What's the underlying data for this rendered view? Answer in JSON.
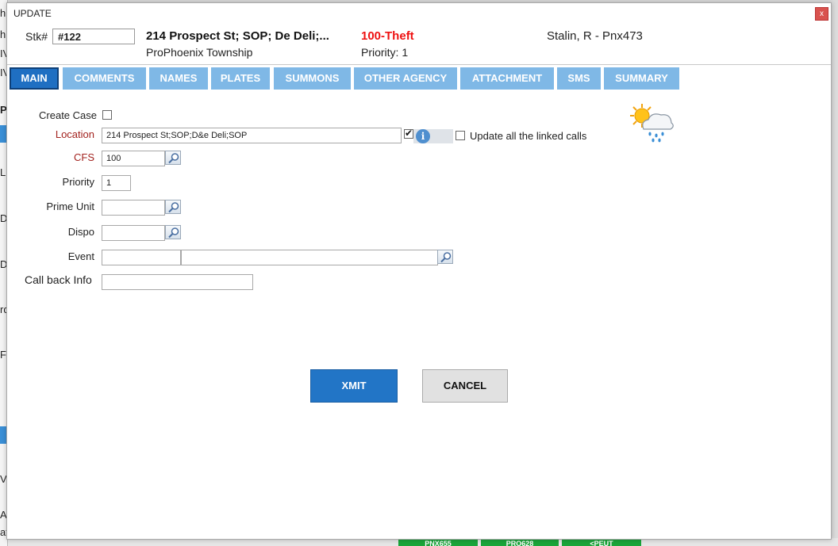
{
  "dialog": {
    "title": "UPDATE",
    "close_label": "x"
  },
  "header": {
    "stk_label": "Stk#",
    "stk_value": "#122",
    "address": "214 Prospect St; SOP; De Deli;...",
    "township": "ProPhoenix Township",
    "call_type": "100-Theft",
    "priority_text": "Priority: 1",
    "dispatcher": "Stalin, R - Pnx473"
  },
  "tabs": [
    {
      "label": "MAIN",
      "active": true
    },
    {
      "label": "COMMENTS"
    },
    {
      "label": "NAMES"
    },
    {
      "label": "PLATES"
    },
    {
      "label": "SUMMONS"
    },
    {
      "label": "OTHER AGENCY"
    },
    {
      "label": "ATTACHMENT"
    },
    {
      "label": "SMS"
    },
    {
      "label": "SUMMARY"
    }
  ],
  "form": {
    "create_case_label": "Create Case",
    "location_label": "Location",
    "location_value": "214 Prospect St;SOP;D&e Deli;SOP",
    "update_linked_label": "Update all the linked calls",
    "cfs_label": "CFS",
    "cfs_value": "100",
    "priority_label": "Priority",
    "priority_value": "1",
    "prime_unit_label": "Prime Unit",
    "prime_unit_value": "",
    "dispo_label": "Dispo",
    "dispo_value": "",
    "event_label": "Event",
    "event_code_value": "",
    "event_desc_value": "",
    "callback_label": "Call back Info",
    "callback_value": ""
  },
  "buttons": {
    "xmit_label": "XMIT",
    "cancel_label": "CANCEL"
  },
  "weather_icon": "sun-cloud-rain-icon",
  "colors": {
    "tab_active": "#1f6fc2",
    "tab_inactive": "#7fb8e6",
    "call_type": "#e11111",
    "required_label": "#a3231f",
    "xmit_button": "#2275c6"
  },
  "background": {
    "left_fragments": [
      "h",
      "h",
      "M",
      "IV",
      "P",
      "L",
      "Da",
      "DI",
      "rd",
      "Fa",
      "V",
      "A",
      "at"
    ],
    "bottom_buttons": [
      "PNX655",
      "PRO628",
      "<PEUT"
    ]
  }
}
